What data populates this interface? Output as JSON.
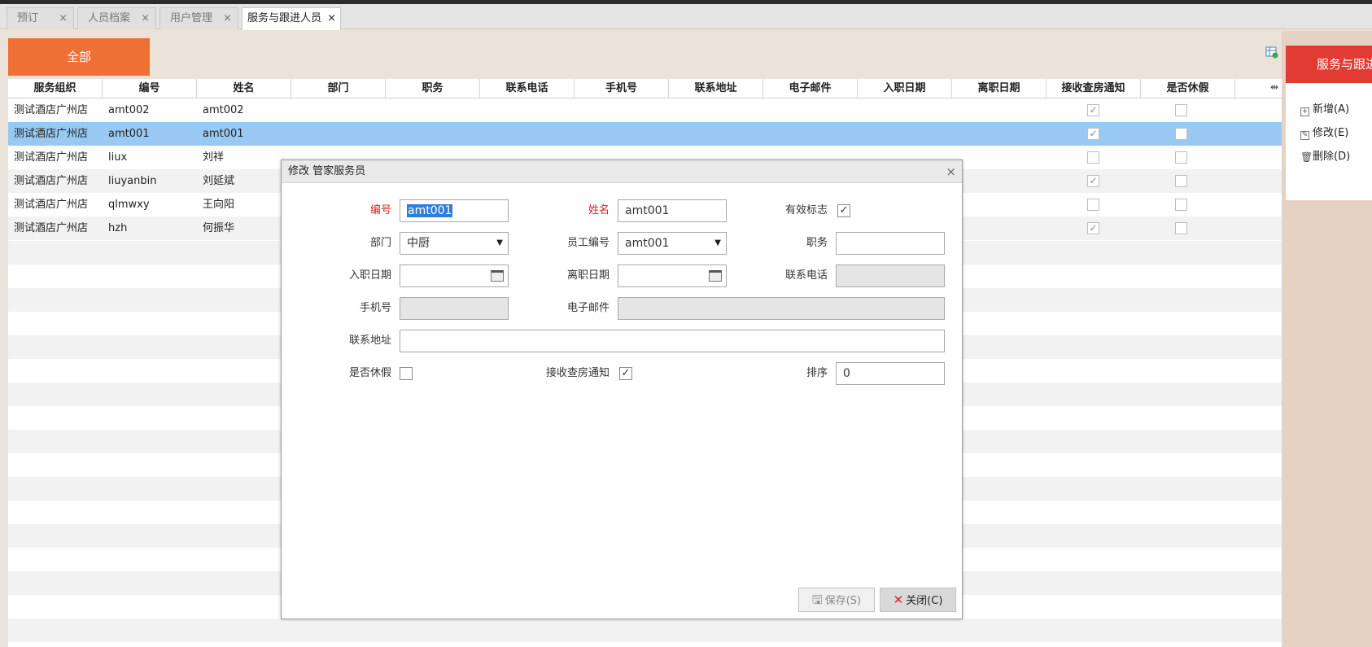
{
  "tabs": [
    {
      "label": "预订",
      "close": "×"
    },
    {
      "label": "人员档案",
      "close": "×"
    },
    {
      "label": "用户管理",
      "close": "×"
    },
    {
      "label": "服务与跟进人员",
      "close": "×"
    }
  ],
  "toolbar": {
    "all_button": "全部"
  },
  "grid": {
    "columns": [
      "服务组织",
      "编号",
      "姓名",
      "部门",
      "职务",
      "联系电话",
      "手机号",
      "联系地址",
      "电子邮件",
      "入职日期",
      "离职日期",
      "接收查房通知",
      "是否休假"
    ],
    "head_more": "⇹",
    "rows": [
      {
        "org": "测试酒店广州店",
        "code": "amt002",
        "name": "amt002",
        "notify": true,
        "vacation": false
      },
      {
        "org": "测试酒店广州店",
        "code": "amt001",
        "name": "amt001",
        "notify": true,
        "vacation": false
      },
      {
        "org": "测试酒店广州店",
        "code": "liux",
        "name": "刘祥",
        "notify": false,
        "vacation": false
      },
      {
        "org": "测试酒店广州店",
        "code": "liuyanbin",
        "name": "刘延斌",
        "notify": true,
        "vacation": false
      },
      {
        "org": "测试酒店广州店",
        "code": "qlmwxy",
        "name": "王向阳",
        "notify": false,
        "vacation": false
      },
      {
        "org": "测试酒店广州店",
        "code": "hzh",
        "name": "何振华",
        "notify": true,
        "vacation": false
      }
    ],
    "selected_row": 1
  },
  "side": {
    "title": "服务与跟进",
    "add": "新增(A)",
    "edit": "修改(E)",
    "delete": "删除(D)"
  },
  "dialog": {
    "title": "修改 管家服务员",
    "close": "×",
    "code_label": "编号",
    "code_value": "amt001",
    "name_label": "姓名",
    "name_value": "amt001",
    "valid_label": "有效标志",
    "dept_label": "部门",
    "dept_value": "中厨",
    "empno_label": "员工编号",
    "empno_value": "amt001",
    "position_label": "职务",
    "position_value": "",
    "entry_label": "入职日期",
    "entry_value": "",
    "leave_label": "离职日期",
    "leave_value": "",
    "phone_label": "联系电话",
    "phone_value": "",
    "mobile_label": "手机号",
    "mobile_value": "",
    "email_label": "电子邮件",
    "email_value": "",
    "address_label": "联系地址",
    "address_value": "",
    "vacation_label": "是否休假",
    "notify_label": "接收查房通知",
    "sort_label": "排序",
    "sort_value": "0",
    "save_button": "保存(S)",
    "close_button": "关闭(C)"
  }
}
